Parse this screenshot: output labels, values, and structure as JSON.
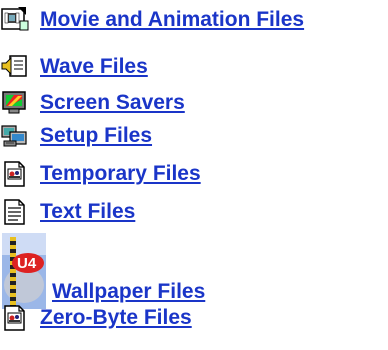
{
  "links": [
    {
      "label": "Movie and Animation Files",
      "icon": "movie-file-icon"
    },
    {
      "label": "Wave Files",
      "icon": "wave-sound-file-icon"
    },
    {
      "label": "Screen Savers",
      "icon": "screen-saver-icon"
    },
    {
      "label": "Setup Files",
      "icon": "setup-computer-icon"
    },
    {
      "label": "Temporary Files",
      "icon": "temporary-file-icon"
    },
    {
      "label": "Text Files",
      "icon": "text-file-icon"
    },
    {
      "label": "Wallpaper Files",
      "icon": "wallpaper-image-icon"
    },
    {
      "label": "Zero-Byte Files",
      "icon": "zero-byte-file-icon"
    }
  ],
  "wallpaper_thumb_text": "U4",
  "colors": {
    "link": "#1a35c8",
    "background": "#ffffff"
  }
}
